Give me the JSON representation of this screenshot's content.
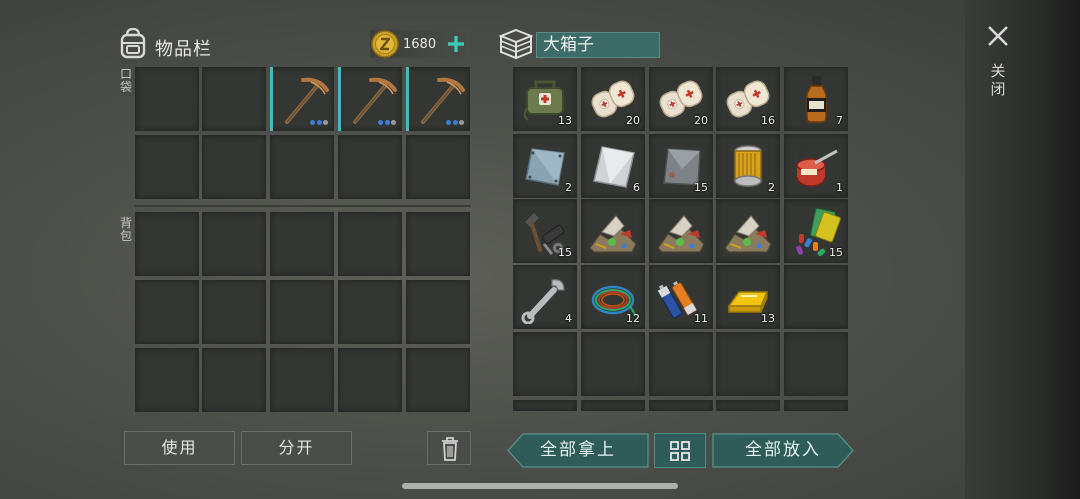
{
  "inventory": {
    "title": "物品栏",
    "currency_amount": "1680",
    "pocket_label": "口袋",
    "backpack_label": "背包",
    "pocket_slots": [
      {
        "item": "",
        "qty": ""
      },
      {
        "item": "",
        "qty": ""
      },
      {
        "item": "pickaxe-icon",
        "qty": "",
        "durability_dots": 3
      },
      {
        "item": "pickaxe-icon",
        "qty": "",
        "durability_dots": 3
      },
      {
        "item": "pickaxe-icon",
        "qty": "",
        "durability_dots": 3
      },
      {
        "item": "",
        "qty": ""
      },
      {
        "item": "",
        "qty": ""
      },
      {
        "item": "",
        "qty": ""
      },
      {
        "item": "",
        "qty": ""
      },
      {
        "item": "",
        "qty": ""
      }
    ],
    "backpack_slot_count": 15,
    "use_label": "使用",
    "split_label": "分开"
  },
  "box": {
    "name": "大箱子",
    "slots": [
      {
        "item": "medkit-bag-icon",
        "qty": "13"
      },
      {
        "item": "bandage-icon",
        "qty": "20"
      },
      {
        "item": "bandage-icon",
        "qty": "20"
      },
      {
        "item": "bandage-icon",
        "qty": "16"
      },
      {
        "item": "whiskey-bottle-icon",
        "qty": "7"
      },
      {
        "item": "metal-plate-blue-icon",
        "qty": "2"
      },
      {
        "item": "metal-plate-silver-icon",
        "qty": "6"
      },
      {
        "item": "metal-plate-dark-icon",
        "qty": "15"
      },
      {
        "item": "oil-filter-icon",
        "qty": "2"
      },
      {
        "item": "oil-can-icon",
        "qty": "1"
      },
      {
        "item": "hammer-parts-icon",
        "qty": "15"
      },
      {
        "item": "scrap-pile-icon",
        "qty": ""
      },
      {
        "item": "scrap-pile-icon",
        "qty": ""
      },
      {
        "item": "scrap-pile-icon",
        "qty": ""
      },
      {
        "item": "pills-cards-icon",
        "qty": "15"
      },
      {
        "item": "wrench-icon",
        "qty": "4"
      },
      {
        "item": "wire-coil-icon",
        "qty": "12"
      },
      {
        "item": "batteries-icon",
        "qty": "11"
      },
      {
        "item": "gold-bar-icon",
        "qty": "13"
      },
      {
        "item": "",
        "qty": ""
      },
      {
        "item": "",
        "qty": ""
      },
      {
        "item": "",
        "qty": ""
      },
      {
        "item": "",
        "qty": ""
      },
      {
        "item": "",
        "qty": ""
      },
      {
        "item": "",
        "qty": ""
      }
    ],
    "take_all_label": "全部拿上",
    "put_all_label": "全部放入"
  },
  "close_label": "关闭",
  "colors": {
    "accent": "#3fc7b2",
    "teal_button": "#2f5c58",
    "durability_blue": "#3d7fd6",
    "slot_bg": "#343633"
  }
}
